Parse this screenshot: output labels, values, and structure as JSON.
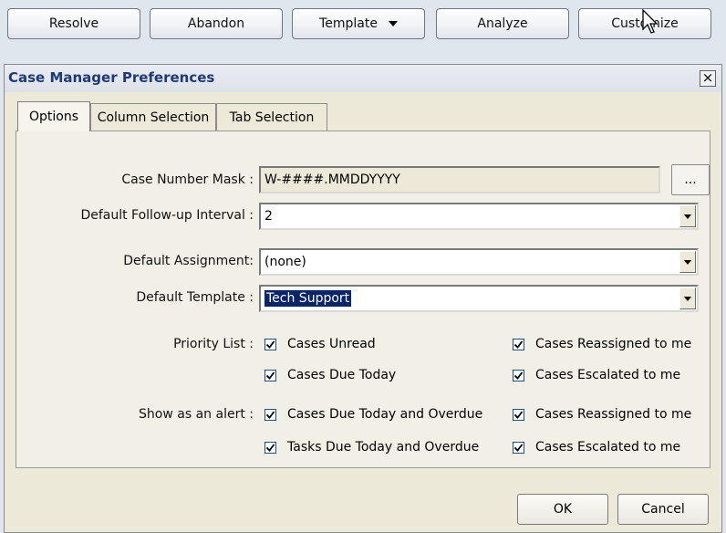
{
  "toolbar": {
    "resolve_label": "Resolve",
    "abandon_label": "Abandon",
    "template_label": "Template",
    "analyze_label": "Analyze",
    "customize_label": "Customize"
  },
  "dialog": {
    "title": "Case Manager Preferences",
    "close_glyph": "×",
    "tabs": [
      "Options",
      "Column Selection",
      "Tab Selection"
    ],
    "active_tab": "Options",
    "case_number_mask": {
      "label": "Case Number Mask :",
      "value": "W-####.MMDDYYYY",
      "browse_label": "..."
    },
    "follow_up": {
      "label": "Default Follow-up Interval :",
      "value": "2"
    },
    "assignment": {
      "label": "Default Assignment:",
      "value": "(none)"
    },
    "template": {
      "label": "Default Template :",
      "value": "Tech Support"
    },
    "priority_list": {
      "label": "Priority List :",
      "options": [
        {
          "label": "Cases Unread",
          "checked": true
        },
        {
          "label": "Cases Reassigned to me",
          "checked": true
        },
        {
          "label": "Cases Due Today",
          "checked": true
        },
        {
          "label": "Cases Escalated to me",
          "checked": true
        }
      ]
    },
    "alerts": {
      "label": "Show as an alert :",
      "options": [
        {
          "label": "Cases Due Today and Overdue",
          "checked": true
        },
        {
          "label": "Cases Reassigned to me",
          "checked": true
        },
        {
          "label": "Tasks Due Today and Overdue",
          "checked": true
        },
        {
          "label": "Cases Escalated to me",
          "checked": true
        }
      ]
    },
    "ok_label": "OK",
    "cancel_label": "Cancel"
  },
  "icons": {
    "checkmark": "checkmark-icon",
    "dropdown": "chevron-down-icon",
    "close": "close-icon",
    "cursor": "mouse-pointer-icon"
  },
  "colors": {
    "selection": "#0a246a",
    "title_text": "#1e3a78",
    "check_border": "#1c5180"
  }
}
